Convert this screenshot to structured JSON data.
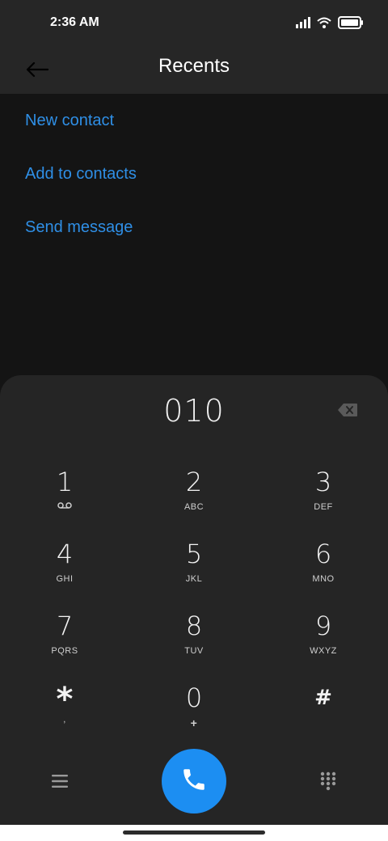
{
  "status_bar": {
    "time": "2:36 AM",
    "icons": [
      "signal-icon",
      "wifi-icon",
      "battery-icon"
    ]
  },
  "header": {
    "title": "Recents",
    "back_icon": "arrow-left-icon"
  },
  "actions": [
    {
      "label": "New contact"
    },
    {
      "label": "Add to contacts"
    },
    {
      "label": "Send message"
    }
  ],
  "dialer": {
    "number": "010",
    "keys": [
      {
        "digit": "1",
        "letters": "",
        "icon": "voicemail-icon"
      },
      {
        "digit": "2",
        "letters": "ABC"
      },
      {
        "digit": "3",
        "letters": "DEF"
      },
      {
        "digit": "4",
        "letters": "GHI"
      },
      {
        "digit": "5",
        "letters": "JKL"
      },
      {
        "digit": "6",
        "letters": "MNO"
      },
      {
        "digit": "7",
        "letters": "PQRS"
      },
      {
        "digit": "8",
        "letters": "TUV"
      },
      {
        "digit": "9",
        "letters": "WXYZ"
      },
      {
        "digit": "*",
        "letters": ","
      },
      {
        "digit": "0",
        "letters": "+"
      },
      {
        "digit": "#",
        "letters": ""
      }
    ]
  },
  "colors": {
    "accent": "#2f8fe6",
    "call_button": "#1c8ef2",
    "sheet": "#252525",
    "background": "#141414"
  }
}
